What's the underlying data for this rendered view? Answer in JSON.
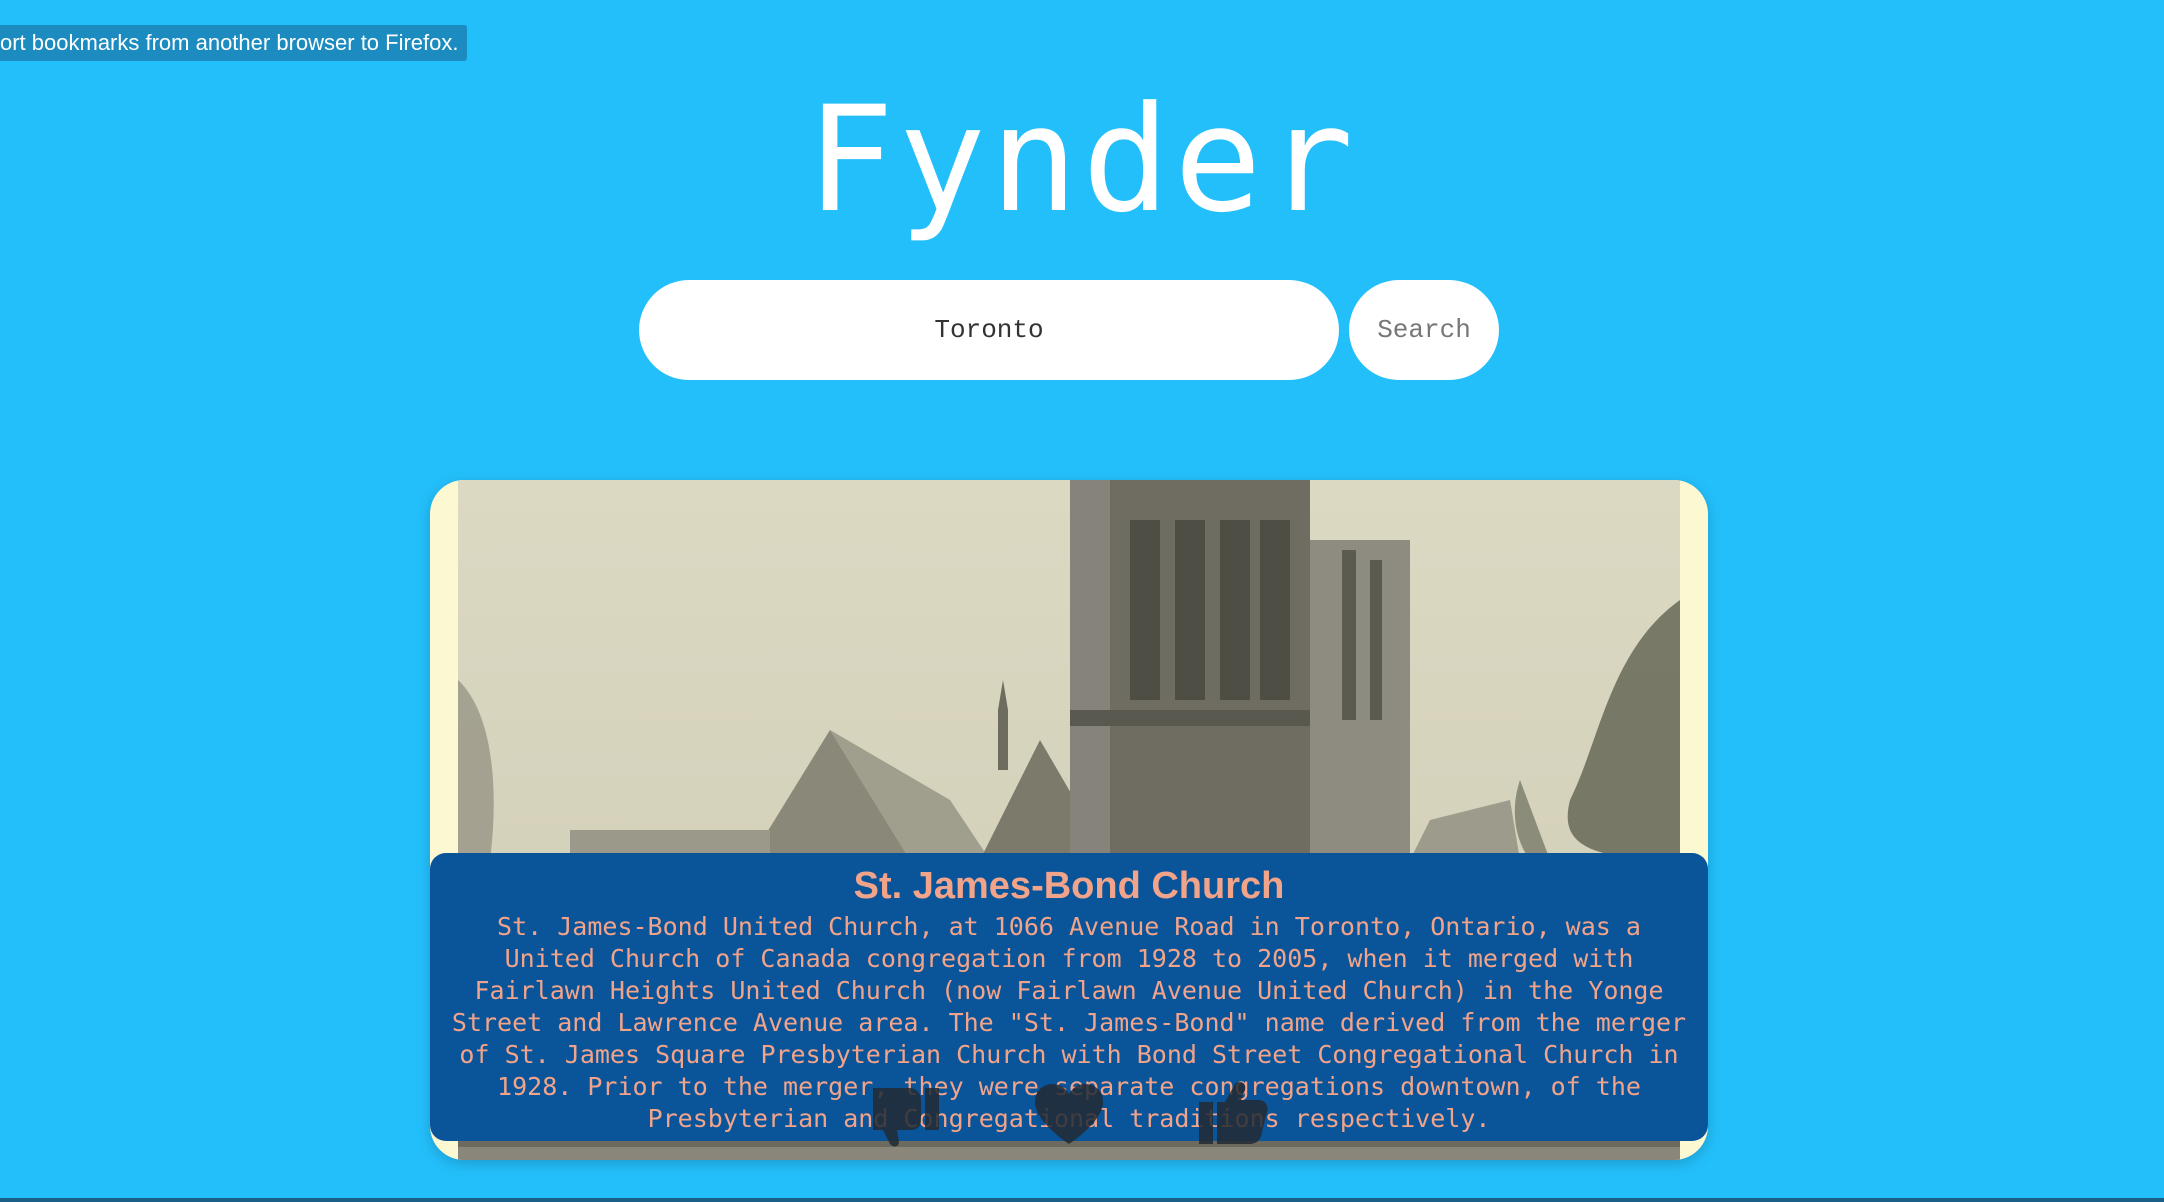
{
  "tooltip": {
    "text": "ort bookmarks from another browser to Firefox."
  },
  "app": {
    "title": "Fynder"
  },
  "search": {
    "value": "Toronto",
    "button_label": "Search"
  },
  "result": {
    "title": "St. James-Bond Church",
    "description": "St. James-Bond United Church, at 1066 Avenue Road in Toronto, Ontario, was a United Church of Canada congregation from 1928 to 2005, when it merged with Fairlawn Heights United Church (now Fairlawn Avenue United Church) in the Yonge Street and Lawrence Avenue area. The \"St. James-Bond\" name derived from the merger of St. James Square Presbyterian Church with Bond Street Congregational Church in 1928. Prior to the merger, they were separate congregations downtown, of the Presbyterian and Congregational traditions respectively."
  },
  "actions": [
    {
      "icon": "dislike-icon"
    },
    {
      "icon": "heart-icon"
    },
    {
      "icon": "like-icon"
    }
  ],
  "colors": {
    "background": "#23bffb",
    "info_panel": "#0a549a",
    "info_text": "#f2a48a",
    "tooltip_bg": "#1c8bbf"
  }
}
